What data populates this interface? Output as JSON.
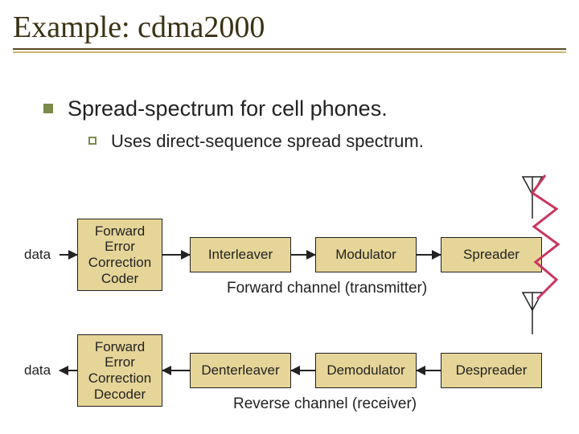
{
  "title": "Example: cdma2000",
  "bullet1": "Spread-spectrum for cell phones.",
  "bullet2": "Uses direct-sequence spread spectrum.",
  "data_label": "data",
  "forward": {
    "box1": "Forward Error Correction Coder",
    "box2": "Interleaver",
    "box3": "Modulator",
    "box4": "Spreader",
    "caption": "Forward channel (transmitter)"
  },
  "reverse": {
    "box1": "Forward Error Correction Decoder",
    "box2": "Denterleaver",
    "box3": "Demodulator",
    "box4": "Despreader",
    "caption": "Reverse channel (receiver)"
  },
  "chart_data": {
    "type": "diagram",
    "flows": [
      {
        "name": "Forward channel (transmitter)",
        "direction": "left-to-right",
        "input": "data",
        "nodes": [
          "Forward Error Correction Coder",
          "Interleaver",
          "Modulator",
          "Spreader"
        ],
        "output": "antenna"
      },
      {
        "name": "Reverse channel (receiver)",
        "direction": "right-to-left",
        "input": "antenna",
        "nodes": [
          "Despreader",
          "Demodulator",
          "Denterleaver",
          "Forward Error Correction Decoder"
        ],
        "output": "data"
      }
    ]
  }
}
